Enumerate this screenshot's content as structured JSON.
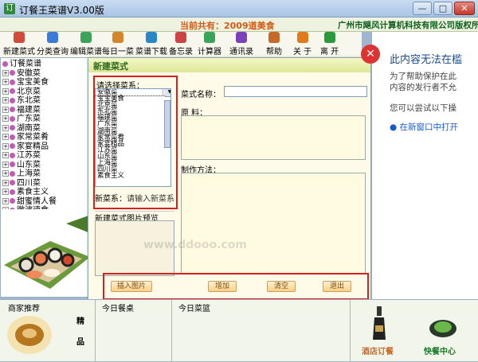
{
  "window": {
    "title": "订餐王菜谱V3.00版",
    "close": "✕"
  },
  "info": {
    "count": "当前共有：2009道美食",
    "corp": "广州市飓风计算机科技有限公司版权所有"
  },
  "toolbar": [
    {
      "label": "新建菜式",
      "icon": "new-dish-icon",
      "color": "#d24a3a"
    },
    {
      "label": "分类查询",
      "icon": "category-search-icon",
      "color": "#3a7bd5"
    },
    {
      "label": "编辑菜谱",
      "icon": "edit-menu-icon",
      "color": "#3aa45a"
    },
    {
      "label": "每日一菜",
      "icon": "daily-dish-icon",
      "color": "#d4862a"
    },
    {
      "label": "菜谱下载",
      "icon": "download-icon",
      "color": "#2a88c7"
    },
    {
      "label": "备忘录",
      "icon": "memo-icon",
      "color": "#c44"
    },
    {
      "label": "计算器",
      "icon": "calculator-icon",
      "color": "#3aa45a"
    },
    {
      "label": "通讯录",
      "icon": "contacts-icon",
      "color": "#7a42b8"
    },
    {
      "label": "帮助",
      "icon": "help-icon",
      "color": "#c46a2a"
    },
    {
      "label": "关 于",
      "icon": "about-icon",
      "color": "#e07a1a"
    },
    {
      "label": "离 开",
      "icon": "exit-icon",
      "color": "#2a9a3a"
    }
  ],
  "tree": {
    "root": "订餐菜谱",
    "items": [
      "安徽菜",
      "宝宝美食",
      "北京菜",
      "东北菜",
      "福建菜",
      "广东菜",
      "湖南菜",
      "家常菜肴",
      "家宴精品",
      "江苏菜",
      "山东菜",
      "上海菜",
      "四川菜",
      "素食主义",
      "甜蜜情人餐",
      "微波速食"
    ]
  },
  "dialog": {
    "title": "新建菜式",
    "select_label": "请选择菜系：",
    "list": [
      "安徽菜",
      "宝宝美食",
      "北京菜",
      "东北菜",
      "福建菜",
      "广东菜",
      "湖南菜",
      "家常菜肴",
      "家宴精品",
      "江苏菜",
      "山东菜",
      "上海菜",
      "四川菜",
      "素食主义"
    ],
    "new_cat_label": "新菜系：",
    "new_cat_placeholder": "请输入新菜系",
    "dish_name_label": "菜式名称：",
    "ingredients_label": "原        料：",
    "method_label": "制作方法：",
    "preview_label": "新建菜式图片预览",
    "buttons": {
      "insert_image": "插入图片",
      "add": "增加",
      "clear": "清空",
      "exit": "退出"
    }
  },
  "right": {
    "blocked_title": "此内容无法在槛",
    "blocked_text1": "为了帮助保护在此",
    "blocked_text2": "内容的发行者不允",
    "blocked_text3": "您可以尝试以下操",
    "new_window": "在新窗口中打开"
  },
  "bottom": {
    "recommend": "商家推荐",
    "recommend_side": "精",
    "recommend_side2": "品",
    "today_table": "今日餐桌",
    "today_basket": "今日菜篮",
    "hotel_order": "酒店订餐",
    "fast_center": "快餐中心"
  },
  "watermark": "www.ddooo.com"
}
